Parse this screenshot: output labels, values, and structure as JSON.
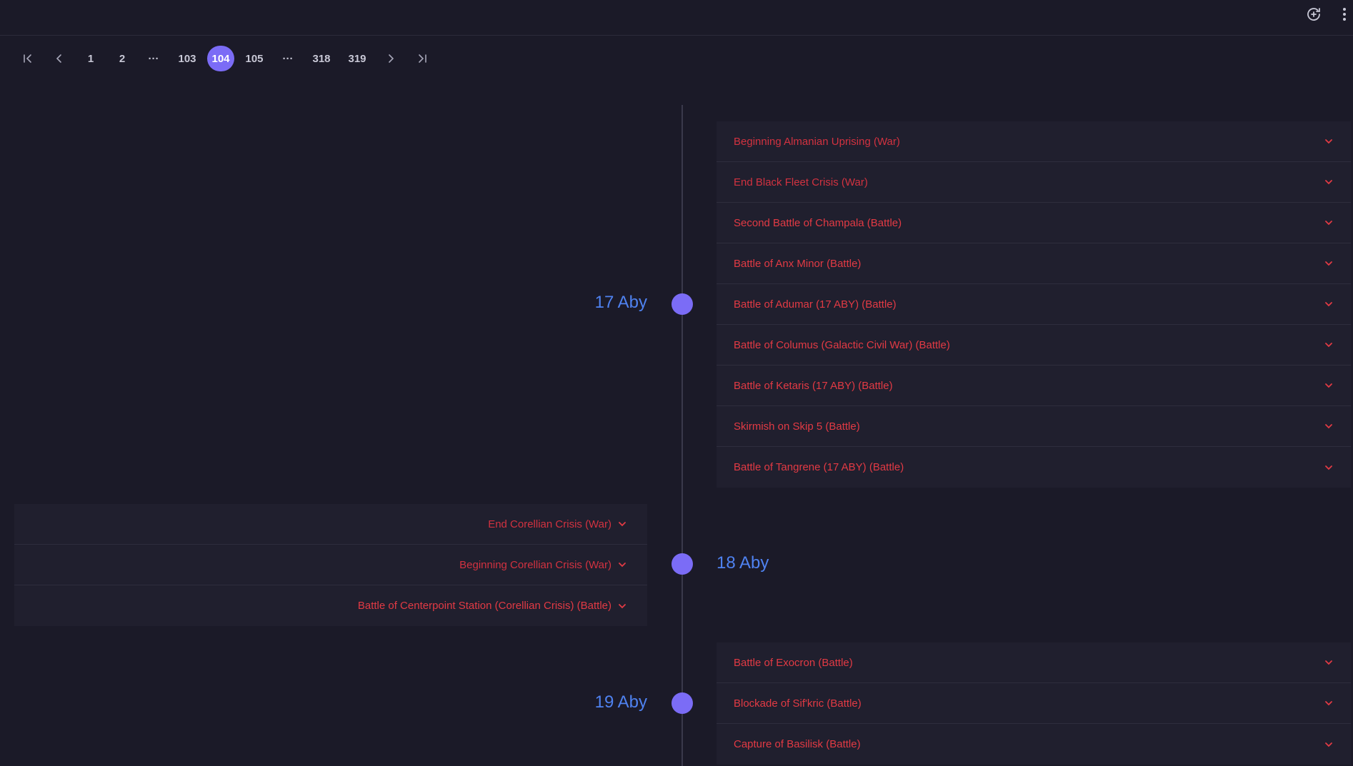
{
  "pagination": {
    "pages": [
      "1",
      "2",
      "···",
      "103",
      "104",
      "105",
      "···",
      "318",
      "319"
    ],
    "current": "104"
  },
  "timeline": [
    {
      "year": "17 Aby",
      "events": [
        "Beginning Almanian Uprising (War)",
        "End Black Fleet Crisis (War)",
        "Second Battle of Champala (Battle)",
        "Battle of Anx Minor (Battle)",
        "Battle of Adumar (17 ABY) (Battle)",
        "Battle of Columus (Galactic Civil War) (Battle)",
        "Battle of Ketaris (17 ABY) (Battle)",
        "Skirmish on Skip 5 (Battle)",
        "Battle of Tangrene (17 ABY) (Battle)"
      ]
    },
    {
      "year": "18 Aby",
      "events": [
        "End Corellian Crisis (War)",
        "Beginning Corellian Crisis (War)",
        "Battle of Centerpoint Station (Corellian Crisis) (Battle)"
      ]
    },
    {
      "year": "19 Aby",
      "events": [
        "Battle of Exocron (Battle)",
        "Blockade of Sif'kric (Battle)",
        "Capture of Basilisk (Battle)"
      ]
    }
  ]
}
